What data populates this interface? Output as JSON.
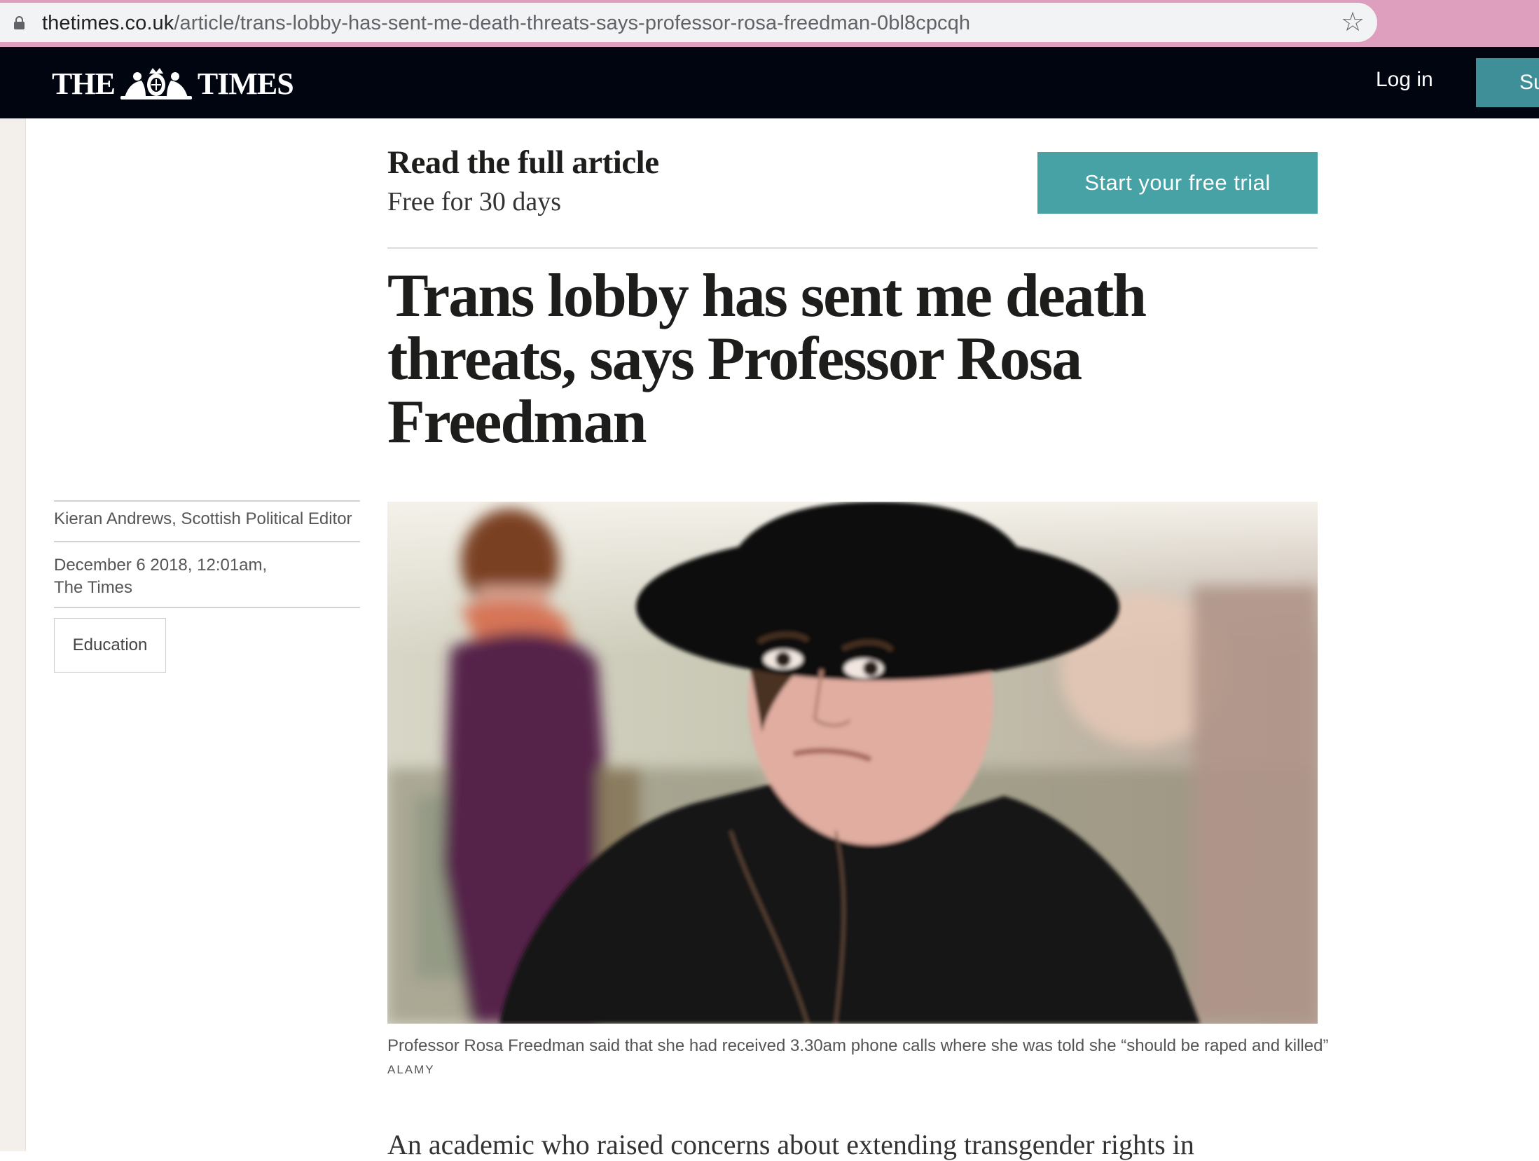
{
  "browser": {
    "url_domain": "thetimes.co.uk",
    "url_path": "/article/trans-lobby-has-sent-me-death-threats-says-professor-rosa-freedman-0bl8cpcqh",
    "star_glyph": "☆"
  },
  "header": {
    "masthead_left": "THE",
    "masthead_right": "TIMES",
    "login_label": "Log in",
    "subscribe_label": "Su"
  },
  "trial_banner": {
    "title": "Read the full article",
    "subtitle": "Free for 30 days",
    "button_label": "Start your free trial"
  },
  "article": {
    "headline": "Trans lobby has sent me death threats, says Professor Rosa Freedman",
    "byline": "Kieran Andrews, Scottish Political Editor",
    "date": "December 6 2018, 12:01am,",
    "publication": "The Times",
    "tag": "Education",
    "caption": "Professor Rosa Freedman said that she had received 3.30am phone calls where she was told she “should be raped and killed”",
    "credit": "ALAMY",
    "body_first_line": "An academic who raised concerns about extending transgender rights in"
  },
  "colors": {
    "browser_frame": "#de9fbe",
    "header_bg": "#010510",
    "accent_teal": "#46a2a5",
    "subscribe_teal": "#3f8f98"
  }
}
